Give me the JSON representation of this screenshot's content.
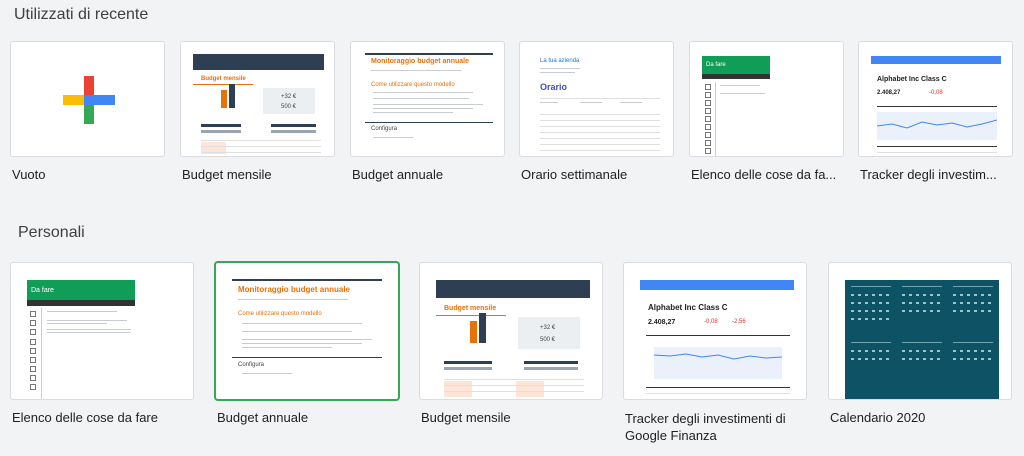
{
  "sections": {
    "recent": "Utilizzati di recente",
    "personal": "Personali"
  },
  "recent": [
    {
      "label": "Vuoto"
    },
    {
      "label": "Budget mensile",
      "title": "Budget mensile",
      "header": "Budget mensile",
      "stats": [
        "+32 €",
        "500 €"
      ]
    },
    {
      "label": "Budget annuale",
      "title": "Monitoraggio budget annuale",
      "subtitle": "Come utilizzare questo modello",
      "footer": "Configura"
    },
    {
      "label": "Orario settimanale",
      "school": "La tua azienda",
      "title": "Orario"
    },
    {
      "label": "Elenco delle cose da fa...",
      "title": "Da fare"
    },
    {
      "label": "Tracker degli investim...",
      "title": "Alphabet Inc Class C",
      "price": "2.408,27"
    }
  ],
  "personal": [
    {
      "label": "Elenco delle cose da fare",
      "title": "Da fare"
    },
    {
      "label": "Budget annuale",
      "title": "Monitoraggio budget annuale",
      "subtitle": "Come utilizzare questo modello",
      "footer": "Configura"
    },
    {
      "label": "Budget mensile",
      "title": "Budget mensile",
      "stats": [
        "+32 €",
        "500 €"
      ]
    },
    {
      "label": "Tracker degli investimenti di Google Finanza",
      "title": "Alphabet Inc Class C",
      "price": "2.408,27"
    },
    {
      "label": "Calendario 2020"
    }
  ],
  "colors": {
    "accent_orange": "#e8710a",
    "navy": "#2e3f54",
    "green": "#0f9d58",
    "teal": "#0e5365",
    "blue": "#1a73e8"
  }
}
